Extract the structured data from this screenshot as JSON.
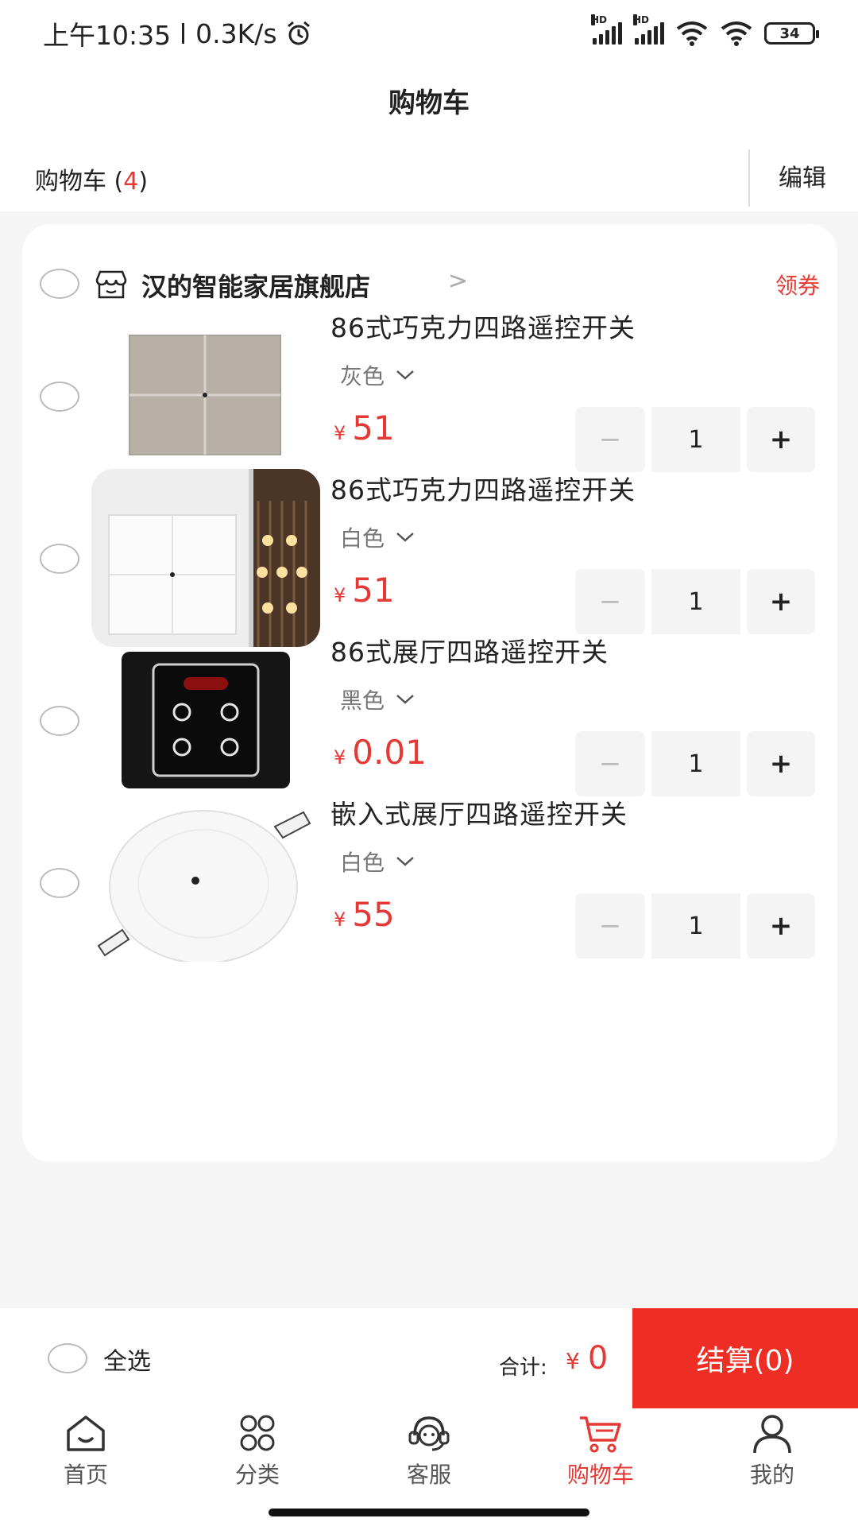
{
  "status_bar": {
    "time": "上午10:35",
    "network_speed": "0.3K/s",
    "battery": "34",
    "icons": [
      "alarm-icon",
      "signal-icon",
      "signal-icon",
      "wifi-icon",
      "wifi-icon",
      "battery-icon"
    ]
  },
  "header": {
    "title": "购物车"
  },
  "sub_header": {
    "label": "购物车",
    "count": "4",
    "edit_label": "编辑"
  },
  "store": {
    "name": "汉的智能家居旗舰店",
    "chevron": ">",
    "coupon_label": "领券",
    "icon": "store-icon"
  },
  "items": [
    {
      "title": "86式巧克力四路遥控开关",
      "variant": "灰色",
      "currency": "¥",
      "price": "51",
      "qty": "1",
      "image": "gray-four-gang-switch"
    },
    {
      "title": "86式巧克力四路遥控开关",
      "variant": "白色",
      "currency": "¥",
      "price": "51",
      "qty": "1",
      "image": "white-four-gang-switch-room"
    },
    {
      "title": "86式展厅四路遥控开关",
      "variant": "黑色",
      "currency": "¥",
      "price": "0.01",
      "qty": "1",
      "image": "black-touch-switch"
    },
    {
      "title": "嵌入式展厅四路遥控开关",
      "variant": "白色",
      "currency": "¥",
      "price": "55",
      "qty": "1",
      "image": "white-round-recessed-switch"
    }
  ],
  "stepper": {
    "minus": "−",
    "plus": "+"
  },
  "checkout": {
    "select_all": "全选",
    "total_label": "合计:",
    "currency": "¥",
    "total_value": "0",
    "button": "结算(0)"
  },
  "tabs": [
    {
      "label": "首页",
      "icon": "home-icon",
      "active": false
    },
    {
      "label": "分类",
      "icon": "category-icon",
      "active": false
    },
    {
      "label": "客服",
      "icon": "customer-service-icon",
      "active": false
    },
    {
      "label": "购物车",
      "icon": "cart-icon",
      "active": true
    },
    {
      "label": "我的",
      "icon": "user-icon",
      "active": false
    }
  ],
  "colors": {
    "accent": "#e53935",
    "checkout_bg": "#ee2d25",
    "page_bg": "#f5f5f5"
  }
}
